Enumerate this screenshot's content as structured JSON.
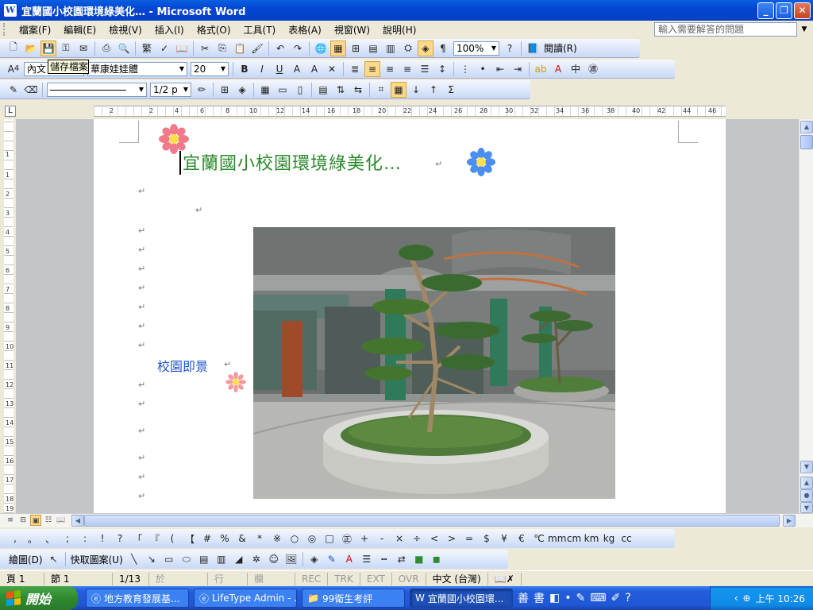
{
  "window": {
    "app_icon": "W",
    "title": "宜蘭國小校園環境綠美化… - Microsoft Word",
    "minimize": "_",
    "restore": "❐",
    "close": "✕"
  },
  "menubar": {
    "items": [
      "檔案(F)",
      "編輯(E)",
      "檢視(V)",
      "插入(I)",
      "格式(O)",
      "工具(T)",
      "表格(A)",
      "視窗(W)",
      "說明(H)"
    ],
    "help_placeholder": "輸入需要解答的問題"
  },
  "standard_toolbar": {
    "zoom": "100%",
    "read_label": "閱讀(R)",
    "tooltip": "儲存檔案"
  },
  "format_toolbar": {
    "style": "內文",
    "font": "華康娃娃體",
    "size": "20"
  },
  "table_toolbar": {
    "line_weight": "1/2 p"
  },
  "ruler": {
    "labels": [
      "2",
      "2",
      "4",
      "6",
      "8",
      "10",
      "12",
      "14",
      "16",
      "18",
      "20",
      "22",
      "24",
      "26",
      "28",
      "30",
      "32",
      "34",
      "36",
      "38",
      "40",
      "42",
      "44",
      "46"
    ]
  },
  "vruler": {
    "labels": [
      "1",
      "1",
      "2",
      "3",
      "4",
      "5",
      "6",
      "7",
      "8",
      "9",
      "10",
      "11",
      "12",
      "13",
      "14",
      "15",
      "16",
      "17",
      "18",
      "19"
    ]
  },
  "document": {
    "title": "宜蘭國小校園環境綠美化…",
    "caption": "校園即景",
    "para_mark": "↵"
  },
  "symbols": [
    ",",
    "。",
    "、",
    ";",
    ":",
    "!",
    "?",
    "「",
    "『",
    "(",
    "【",
    "#",
    "%",
    "&",
    "*",
    "※",
    "○",
    "◎",
    "□",
    "㊣",
    "+",
    "-",
    "×",
    "÷",
    "<",
    ">",
    "=",
    "$",
    "¥",
    "€",
    "℃",
    "mm",
    "cm",
    "km",
    "kg",
    "cc"
  ],
  "drawing_toolbar": {
    "draw_label": "繪圖(D)",
    "autoshapes_label": "快取圖案(U)"
  },
  "statusbar": {
    "page": "頁 1",
    "section": "節 1",
    "pages": "1/13",
    "at": "於",
    "line": "行",
    "col": "欄",
    "rec": "REC",
    "trk": "TRK",
    "ext": "EXT",
    "ovr": "OVR",
    "lang": "中文 (台灣)"
  },
  "taskbar": {
    "start": "開始",
    "tasks": [
      "地方教育發展基...",
      "LifeType Admin - ...",
      "99衛生考評",
      "宜蘭國小校園環..."
    ],
    "clock": "上午 10:26"
  },
  "colors": {
    "title_green": "#2a8a2a",
    "caption_blue": "#2255cc",
    "titlebar_blue": "#0346d2",
    "flower_pink": "#f07a8a",
    "flower_blue": "#4a8ef0"
  }
}
